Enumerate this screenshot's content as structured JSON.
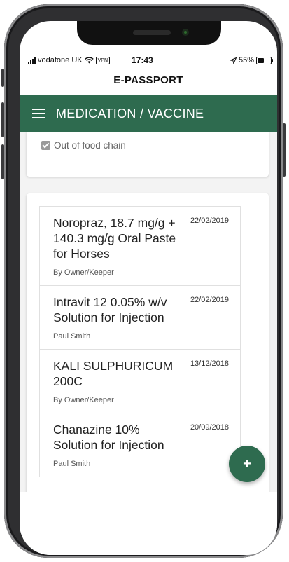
{
  "status": {
    "carrier": "vodafone UK",
    "vpn": "VPN",
    "time": "17:43",
    "battery": "55%",
    "battery_level": 0.55
  },
  "app": {
    "title": "E-PASSPORT"
  },
  "header": {
    "title": "MEDICATION / VACCINE"
  },
  "summary": {
    "food_chain_label": "Out of food chain",
    "food_chain_checked": true
  },
  "medications": [
    {
      "name": "Noropraz, 18.7 mg/g + 140.3 mg/g Oral Paste for Horses",
      "date": "22/02/2019",
      "by": "By Owner/Keeper"
    },
    {
      "name": "Intravit 12 0.05% w/v Solution for Injection",
      "date": "22/02/2019",
      "by": "Paul Smith"
    },
    {
      "name": "KALI SULPHURICUM 200C",
      "date": "13/12/2018",
      "by": "By Owner/Keeper"
    },
    {
      "name": "Chanazine 10% Solution for Injection",
      "date": "20/09/2018",
      "by": "Paul Smith"
    }
  ],
  "fab": {
    "label": "+"
  }
}
